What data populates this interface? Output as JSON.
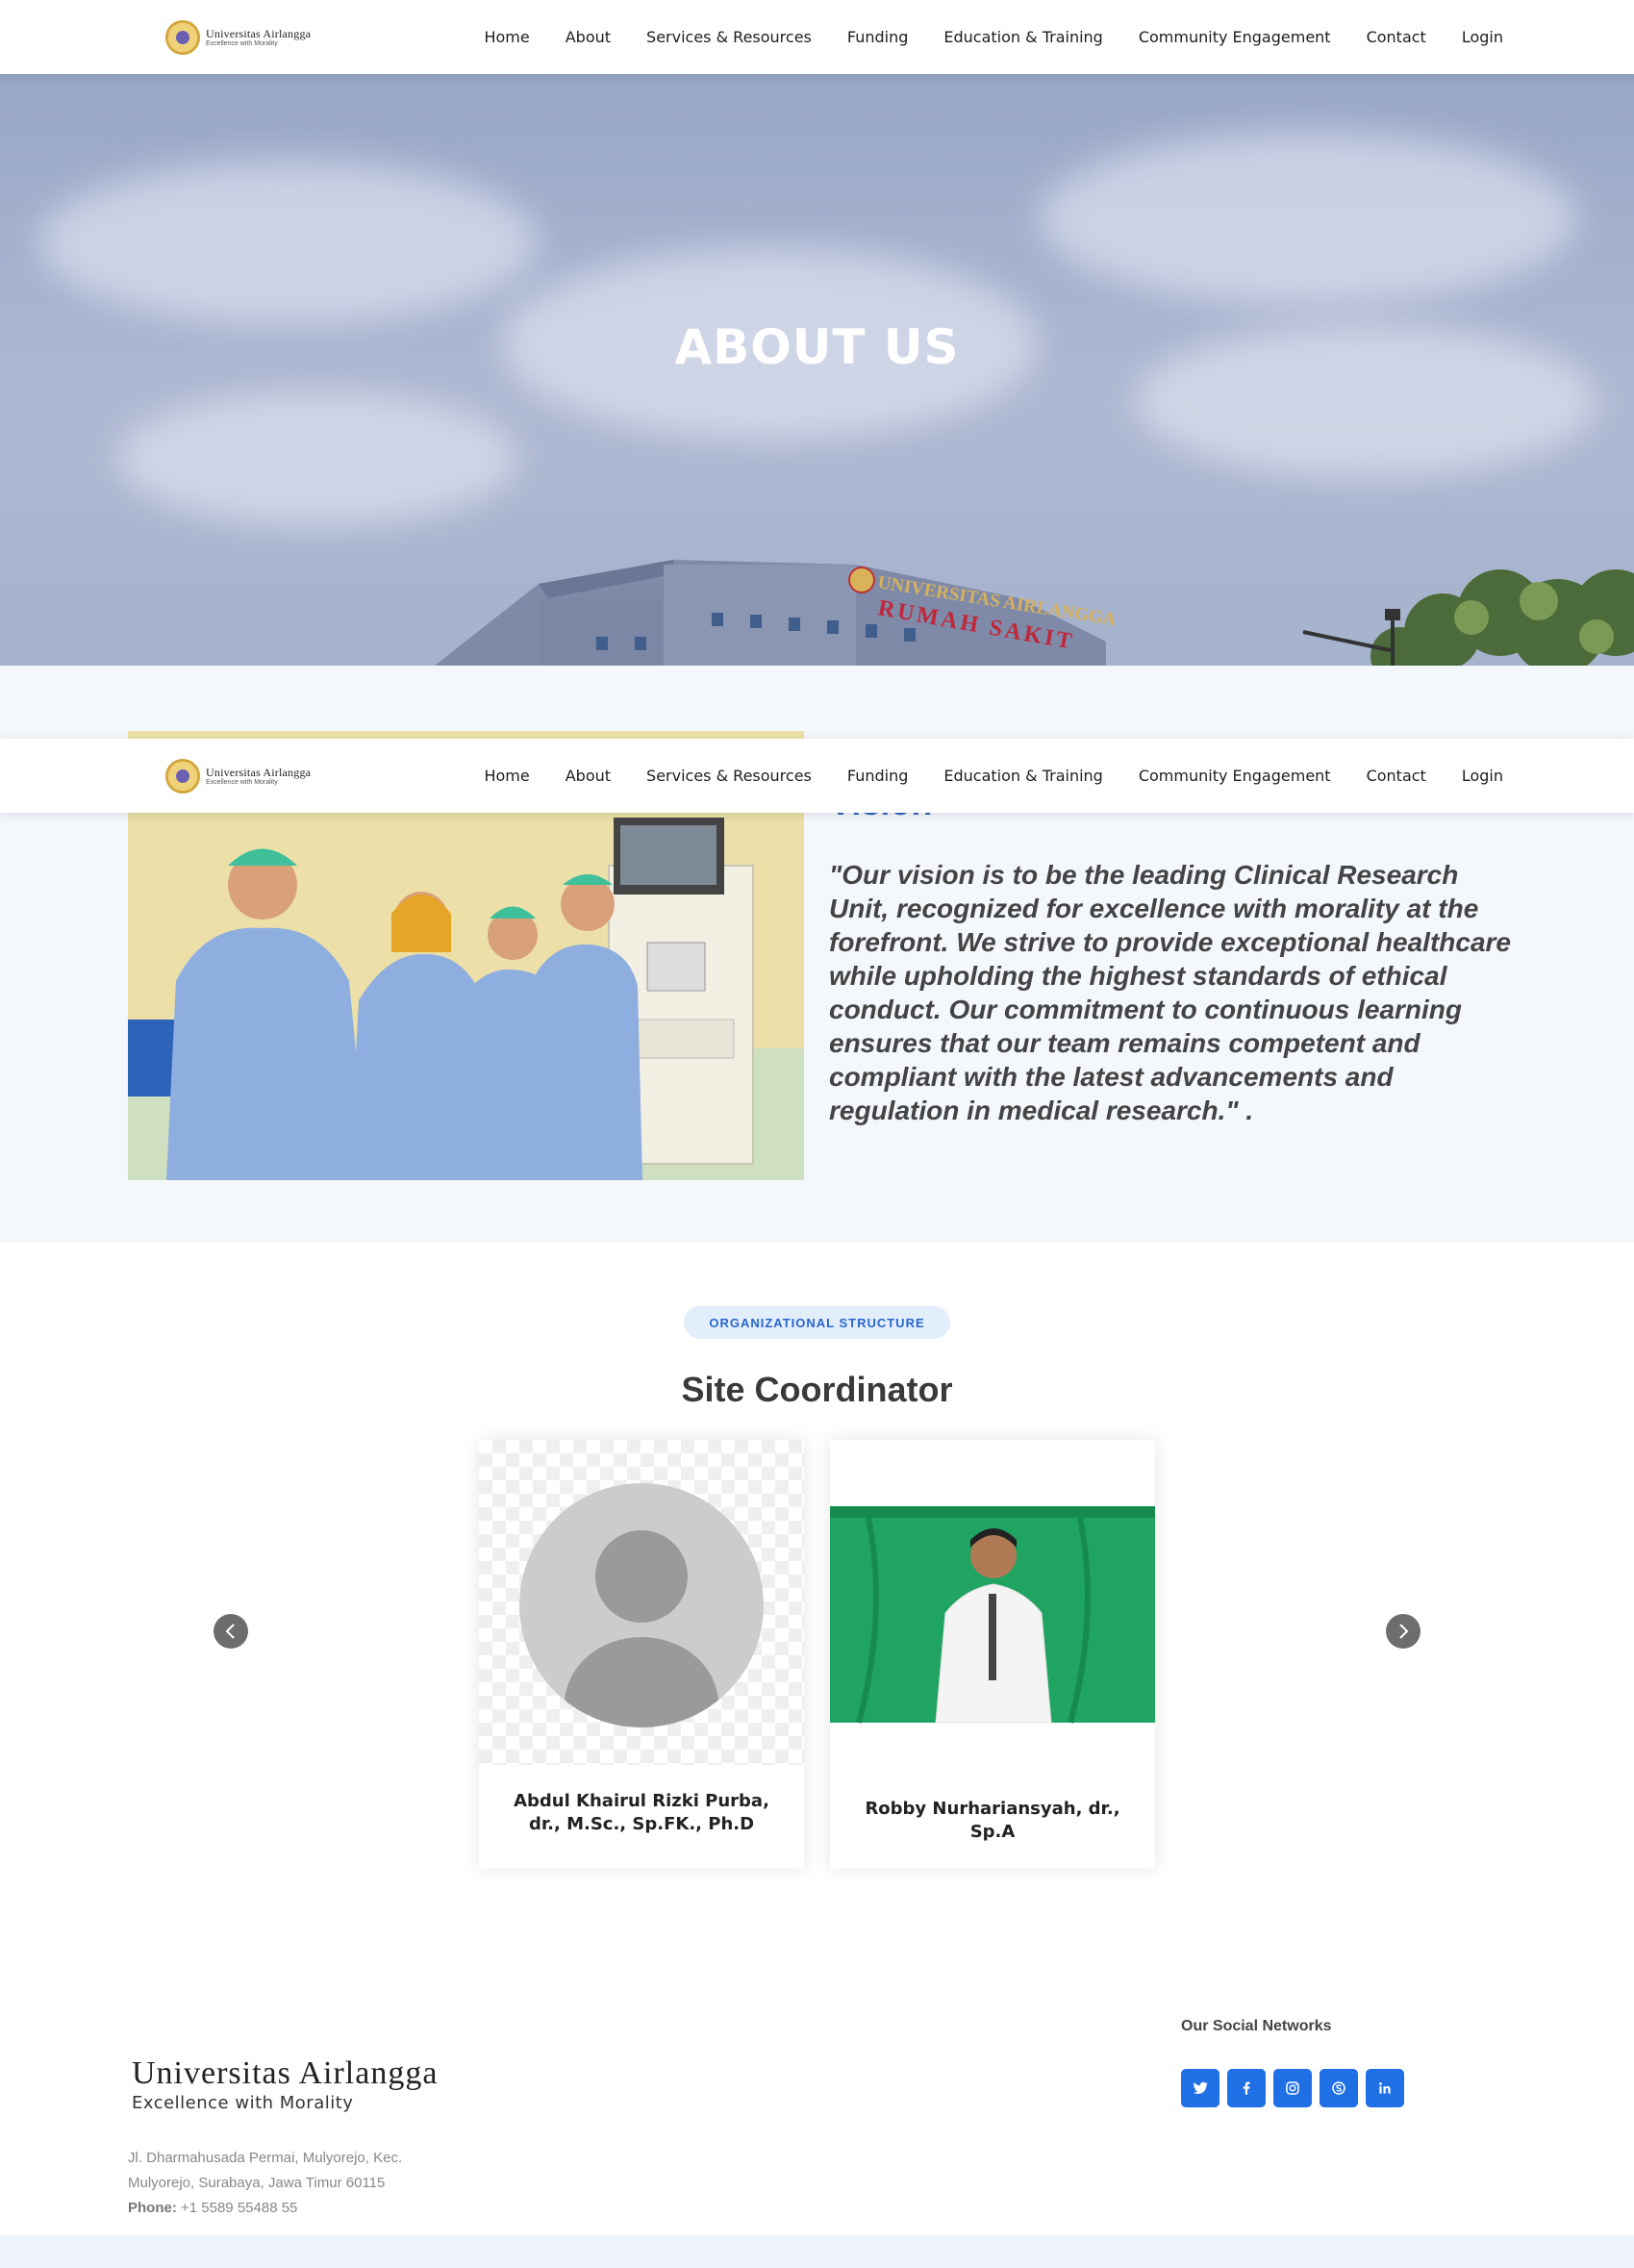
{
  "brand": {
    "name": "Universitas Airlangga",
    "tagline": "Excellence with Morality"
  },
  "nav": {
    "items": [
      {
        "label": "Home"
      },
      {
        "label": "About"
      },
      {
        "label": "Services & Resources"
      },
      {
        "label": "Funding"
      },
      {
        "label": "Education & Training"
      },
      {
        "label": "Community Engagement"
      },
      {
        "label": "Contact"
      },
      {
        "label": "Login"
      }
    ]
  },
  "hero": {
    "title": "ABOUT US",
    "building_sign_line1": "UNIVERSITAS AIRLANGGA",
    "building_sign_line2": "RUMAH SAKIT"
  },
  "vision": {
    "heading": "Vision",
    "text": "\"Our vision is to be the leading Clinical Research Unit, recognized for excellence with morality at the forefront. We strive to provide exceptional healthcare while upholding the highest standards of ethical conduct. Our commitment to continuous learning ensures that our team remains competent and compliant with the latest advancements and regulation in medical research.\" ."
  },
  "org": {
    "badge": "ORGANIZATIONAL STRUCTURE",
    "title": "Site Coordinator",
    "members": [
      {
        "name": "Abdul Khairul Rizki Purba, dr., M.Sc., Sp.FK., Ph.D"
      },
      {
        "name": "Robby Nurhariansyah, dr., Sp.A"
      }
    ]
  },
  "footer": {
    "logo_name": "Universitas Airlangga",
    "logo_tagline": "Excellence with Morality",
    "address_line1": "Jl. Dharmahusada Permai, Mulyorejo, Kec.",
    "address_line2": "Mulyorejo, Surabaya, Jawa Timur 60115",
    "phone_label": "Phone:",
    "phone": "+1 5589 55488 55",
    "social_title": "Our Social Networks",
    "social": [
      "twitter-icon",
      "facebook-icon",
      "instagram-icon",
      "skype-icon",
      "linkedin-icon"
    ]
  },
  "colors": {
    "accent": "#1f6fe5",
    "badge_bg": "#e3eefd",
    "badge_text": "#2866c9",
    "section_bg": "#f4f7fc"
  }
}
